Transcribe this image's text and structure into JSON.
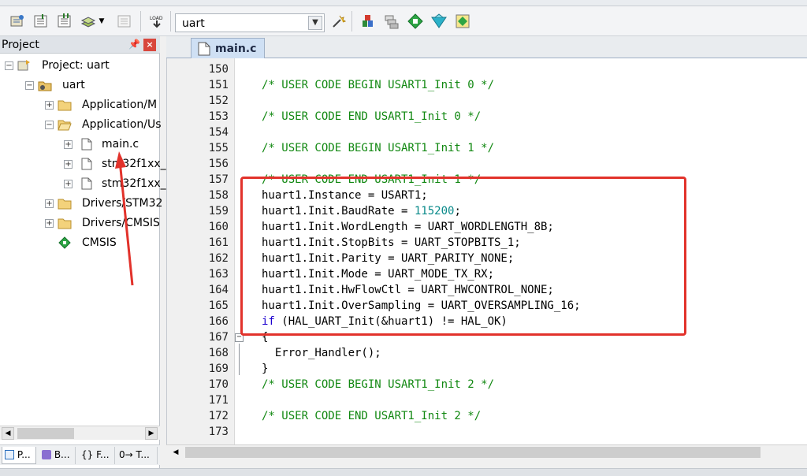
{
  "toolbar": {
    "target": "uart",
    "target_dropdown_icon": "chevron-down-icon",
    "load_label": "LOAD"
  },
  "project_panel": {
    "title": "Project",
    "pin_icon": "pin-icon",
    "close_icon": "close-icon",
    "tree": [
      {
        "label": "Project: uart",
        "expander": "−",
        "icon": "project-icon"
      },
      {
        "label": "uart",
        "expander": "−",
        "icon": "target-folder-icon"
      },
      {
        "label": "Application/M",
        "expander": "+",
        "icon": "folder-icon"
      },
      {
        "label": "Application/Us",
        "expander": "−",
        "icon": "folder-open-icon"
      },
      {
        "label": "main.c",
        "expander": "+",
        "icon": "file-icon"
      },
      {
        "label": "stm32f1xx_",
        "expander": "+",
        "icon": "file-icon"
      },
      {
        "label": "stm32f1xx_",
        "expander": "+",
        "icon": "file-icon"
      },
      {
        "label": "Drivers/STM32",
        "expander": "+",
        "icon": "folder-icon"
      },
      {
        "label": "Drivers/CMSIS",
        "expander": "+",
        "icon": "folder-icon"
      },
      {
        "label": "CMSIS",
        "expander": "",
        "icon": "cmsis-diamond-icon"
      }
    ],
    "bottom_tabs": [
      "P...",
      "B...",
      "{} F...",
      "0→ T..."
    ]
  },
  "editor": {
    "tab": "main.c",
    "lines": [
      {
        "n": "150",
        "text": "",
        "cls": ""
      },
      {
        "n": "151",
        "text": "/* USER CODE BEGIN USART1_Init 0 */",
        "cls": "cm"
      },
      {
        "n": "152",
        "text": "",
        "cls": ""
      },
      {
        "n": "153",
        "text": "/* USER CODE END USART1_Init 0 */",
        "cls": "cm"
      },
      {
        "n": "154",
        "text": "",
        "cls": ""
      },
      {
        "n": "155",
        "text": "/* USER CODE BEGIN USART1_Init 1 */",
        "cls": "cm"
      },
      {
        "n": "156",
        "text": "",
        "cls": ""
      },
      {
        "n": "157",
        "text": "/* USER CODE END USART1_Init 1 */",
        "cls": "cm"
      },
      {
        "n": "158",
        "text": "huart1.Instance = USART1;",
        "cls": ""
      },
      {
        "n": "159",
        "text": "huart1.Init.BaudRate = 115200;",
        "cls": "baud"
      },
      {
        "n": "160",
        "text": "huart1.Init.WordLength = UART_WORDLENGTH_8B;",
        "cls": ""
      },
      {
        "n": "161",
        "text": "huart1.Init.StopBits = UART_STOPBITS_1;",
        "cls": ""
      },
      {
        "n": "162",
        "text": "huart1.Init.Parity = UART_PARITY_NONE;",
        "cls": ""
      },
      {
        "n": "163",
        "text": "huart1.Init.Mode = UART_MODE_TX_RX;",
        "cls": ""
      },
      {
        "n": "164",
        "text": "huart1.Init.HwFlowCtl = UART_HWCONTROL_NONE;",
        "cls": ""
      },
      {
        "n": "165",
        "text": "huart1.Init.OverSampling = UART_OVERSAMPLING_16;",
        "cls": ""
      },
      {
        "n": "166",
        "text": "if (HAL_UART_Init(&huart1) != HAL_OK)",
        "cls": "if"
      },
      {
        "n": "167",
        "text": "{",
        "cls": "",
        "indent": 0
      },
      {
        "n": "168",
        "text": "  Error_Handler();",
        "cls": ""
      },
      {
        "n": "169",
        "text": "}",
        "cls": ""
      },
      {
        "n": "170",
        "text": "/* USER CODE BEGIN USART1_Init 2 */",
        "cls": "cm"
      },
      {
        "n": "171",
        "text": "",
        "cls": ""
      },
      {
        "n": "172",
        "text": "/* USER CODE END USART1_Init 2 */",
        "cls": "cm"
      },
      {
        "n": "173",
        "text": "",
        "cls": ""
      }
    ]
  },
  "colors": {
    "comment": "#118811",
    "keyword": "#1c00cf",
    "number": "#0a8a8a",
    "highlight_box": "#e2322b"
  }
}
